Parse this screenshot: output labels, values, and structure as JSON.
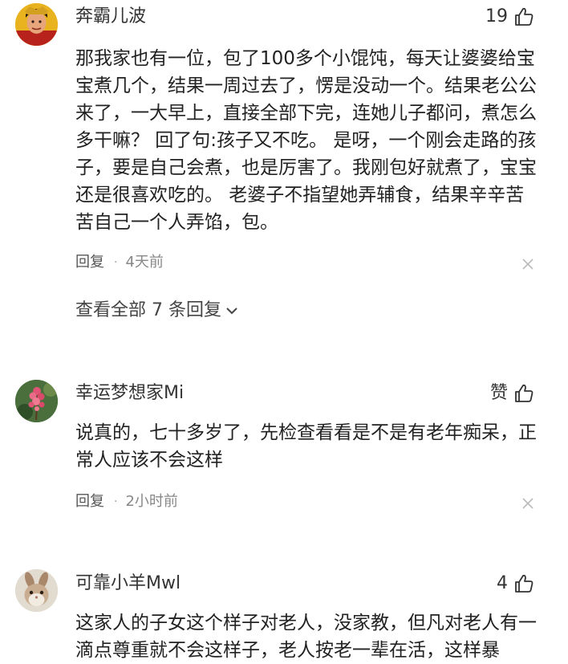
{
  "comments": [
    {
      "username": "奔霸儿波",
      "likes": "19",
      "avatar_icon": "person-portrait-avatar",
      "text": "那我家也有一位，包了100多个小馄饨，每天让婆婆给宝宝煮几个，结果一周过去了，愣是没动一个。结果老公公来了，一大早上，直接全部下完，连她儿子都问，煮怎么多干嘛？ 回了句:孩子又不吃。 是呀，一个刚会走路的孩子，要是自己会煮，也是厉害了。我刚包好就煮了，宝宝还是很喜欢吃的。 老婆子不指望她弄辅食，结果辛辛苦苦自己一个人弄馅，包。",
      "reply_label": "回复",
      "time": "4天前",
      "view_all": "查看全部 7 条回复"
    },
    {
      "username": "幸运梦想家Mi",
      "likes": "赞",
      "avatar_icon": "flower-avatar",
      "text": "说真的，七十多岁了，先检查看看是不是有老年痴呆，正常人应该不会这样",
      "reply_label": "回复",
      "time": "2小时前"
    },
    {
      "username": "可靠小羊Mwl",
      "likes": "4",
      "avatar_icon": "rabbit-avatar",
      "text": "这家人的子女这个样子对老人，没家教，但凡对老人有一滴点尊重就不会这样子，老人按老一辈在活，这样暴"
    }
  ],
  "colors": {
    "text": "#222222",
    "meta": "#888888",
    "icon": "#333333"
  }
}
